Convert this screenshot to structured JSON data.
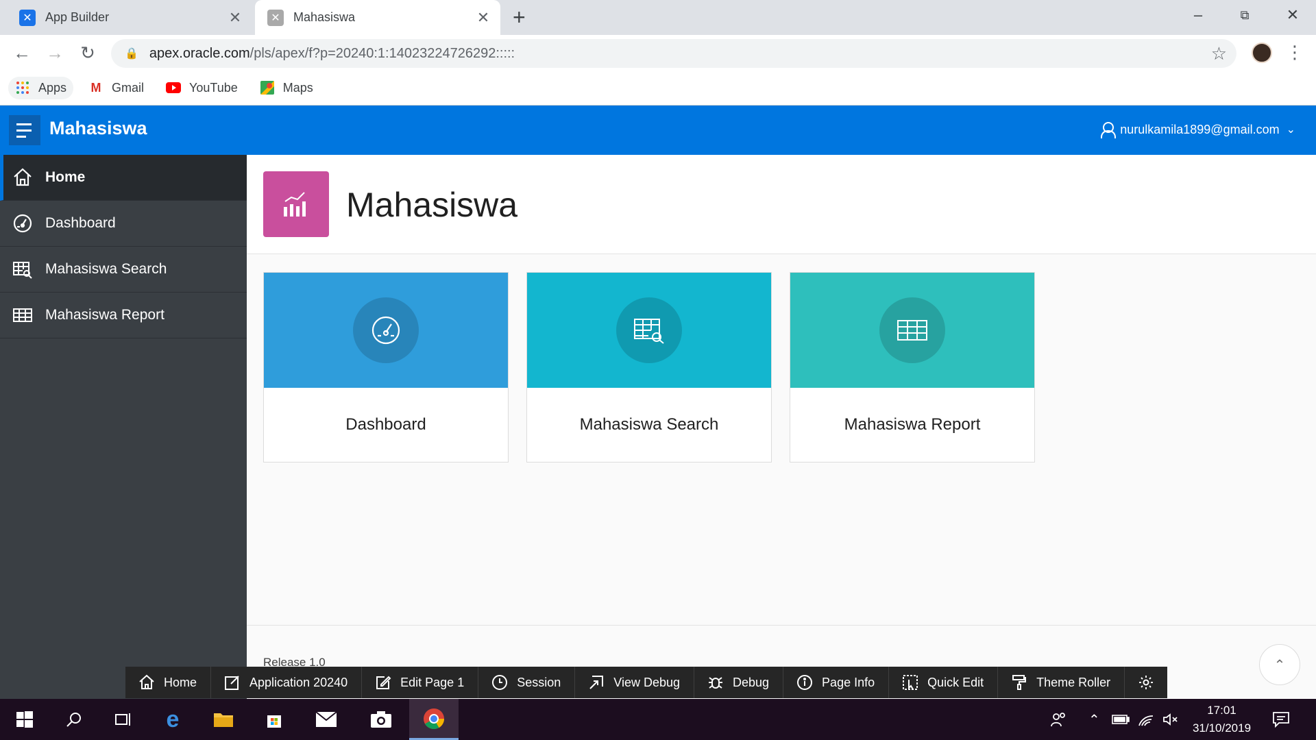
{
  "browser": {
    "tabs": [
      {
        "title": "App Builder",
        "active": false
      },
      {
        "title": "Mahasiswa",
        "active": true
      }
    ],
    "new_tab": "+",
    "address": {
      "host": "apex.oracle.com",
      "path": "/pls/apex/f?p=20240:1:14023224726292:::::"
    },
    "bookmarks": [
      {
        "label": "Apps",
        "icon": "apps-grid-icon"
      },
      {
        "label": "Gmail",
        "icon": "gmail-icon"
      },
      {
        "label": "YouTube",
        "icon": "youtube-icon"
      },
      {
        "label": "Maps",
        "icon": "maps-icon"
      }
    ]
  },
  "header": {
    "app_title": "Mahasiswa",
    "user": "nurulkamila1899@gmail.com",
    "brand_color": "#0076df"
  },
  "sidebar": {
    "items": [
      {
        "label": "Home",
        "icon": "home-icon",
        "active": true
      },
      {
        "label": "Dashboard",
        "icon": "dashboard-icon",
        "active": false
      },
      {
        "label": "Mahasiswa Search",
        "icon": "table-search-icon",
        "active": false
      },
      {
        "label": "Mahasiswa Report",
        "icon": "table-icon",
        "active": false
      }
    ]
  },
  "page": {
    "title": "Mahasiswa",
    "hero_icon": "chart-icon",
    "hero_color": "#c94f9d"
  },
  "cards": [
    {
      "label": "Dashboard",
      "icon": "dashboard-icon",
      "color": "#2f9ddb"
    },
    {
      "label": "Mahasiswa Search",
      "icon": "table-search-icon",
      "color": "#13b6cf"
    },
    {
      "label": "Mahasiswa Report",
      "icon": "table-icon",
      "color": "#2ebfbc"
    }
  ],
  "footer": {
    "release": "Release 1.0"
  },
  "dev_toolbar": [
    {
      "label": "Home",
      "icon": "home-icon"
    },
    {
      "label": "Application 20240",
      "icon": "edit-app-icon"
    },
    {
      "label": "Edit Page 1",
      "icon": "edit-page-icon"
    },
    {
      "label": "Session",
      "icon": "clock-icon"
    },
    {
      "label": "View Debug",
      "icon": "view-debug-icon"
    },
    {
      "label": "Debug",
      "icon": "bug-icon"
    },
    {
      "label": "Page Info",
      "icon": "info-icon"
    },
    {
      "label": "Quick Edit",
      "icon": "quick-edit-icon"
    },
    {
      "label": "Theme Roller",
      "icon": "paint-roller-icon"
    },
    {
      "label": "",
      "icon": "gear-icon"
    }
  ],
  "taskbar": {
    "time": "17:01",
    "date": "31/10/2019"
  }
}
